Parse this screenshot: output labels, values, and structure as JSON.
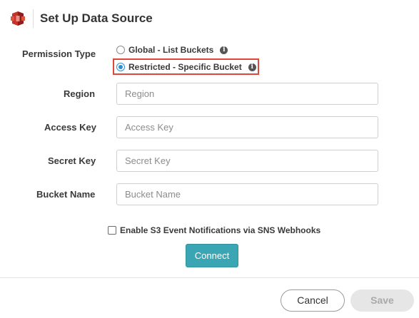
{
  "header": {
    "title": "Set Up Data Source",
    "logo_icon": "aws-s3-bucket-icon",
    "logo_colors": [
      "#c7322b",
      "#e0523d",
      "#8f1e1a"
    ]
  },
  "form": {
    "permission_type": {
      "label": "Permission Type",
      "options": [
        {
          "label": "Global - List Buckets",
          "selected": false
        },
        {
          "label": "Restricted - Specific Bucket",
          "selected": true
        }
      ],
      "info_icon": "info-icon",
      "highlight_color": "#e0473b"
    },
    "region": {
      "label": "Region",
      "value": "",
      "placeholder": "Region"
    },
    "access_key": {
      "label": "Access Key",
      "value": "",
      "placeholder": "Access Key"
    },
    "secret_key": {
      "label": "Secret Key",
      "value": "",
      "placeholder": "Secret Key"
    },
    "bucket_name": {
      "label": "Bucket Name",
      "value": "",
      "placeholder": "Bucket Name"
    },
    "sns_checkbox": {
      "label": "Enable S3 Event Notifications via SNS Webhooks",
      "checked": false
    },
    "connect_label": "Connect",
    "accent_color": "#3aa6b4"
  },
  "footer": {
    "cancel_label": "Cancel",
    "save_label": "Save",
    "save_disabled": true
  }
}
